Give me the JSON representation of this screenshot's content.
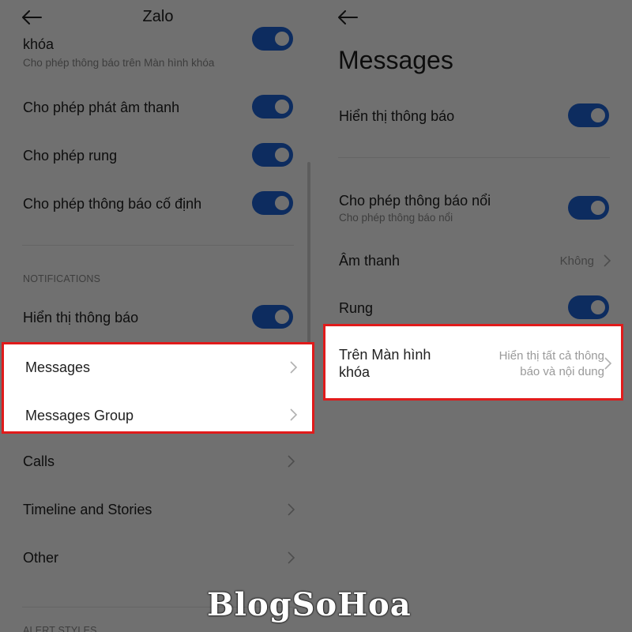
{
  "left": {
    "title": "Zalo",
    "lockscreen": {
      "title_tail": "khóa",
      "subtitle": "Cho phép thông báo trên Màn hình khóa"
    },
    "allow_sound": "Cho phép phát âm thanh",
    "allow_vibrate": "Cho phép rung",
    "allow_persistent": "Cho phép thông báo cố định",
    "section_notifications": "NOTIFICATIONS",
    "show_notifications": "Hiển thị thông báo",
    "channels": [
      "Messages",
      "Messages Group",
      "Calls",
      "Timeline and Stories",
      "Other"
    ],
    "section_alert_styles": "ALERT STYLES"
  },
  "right": {
    "title": "Messages",
    "show_notifications": "Hiển thị thông báo",
    "floating": {
      "title": "Cho phép thông báo nổi",
      "subtitle": "Cho phép thông báo nổi"
    },
    "sound": {
      "label": "Âm thanh",
      "value": "Không"
    },
    "vibrate": "Rung",
    "lock_screen": {
      "title_line1": "Trên Màn hình",
      "title_line2": "khóa",
      "value_line1": "Hiển thị tất cả thông",
      "value_line2": "báo và nội dung"
    }
  },
  "watermark": "BlogSoHoa",
  "colors": {
    "toggle_on": "#1e64d9",
    "highlight_border": "#e01b1b"
  },
  "icons": {
    "back": "arrow-left-icon",
    "chevron": "chevron-right-icon"
  }
}
